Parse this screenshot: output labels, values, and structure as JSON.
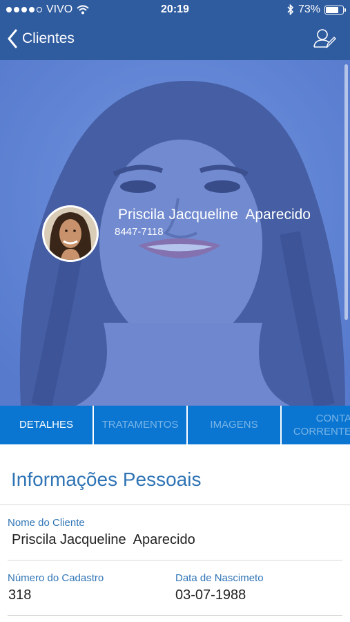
{
  "status_bar": {
    "carrier": "VIVO",
    "time": "20:19",
    "battery_percent": "73%",
    "battery_level": 0.73,
    "icons": [
      "signal-dots-icon",
      "wifi-icon",
      "bluetooth-icon",
      "battery-icon"
    ]
  },
  "nav": {
    "back_label": "Clientes",
    "back_icon": "chevron-left-icon",
    "right_icon": "edit-user-icon"
  },
  "profile": {
    "name": "Priscila Jacqueline  Aparecido",
    "phone": "8447-7118"
  },
  "tabs": [
    {
      "label": "DETALHES",
      "active": true
    },
    {
      "label": "TRATAMENTOS",
      "active": false
    },
    {
      "label": "IMAGENS",
      "active": false
    },
    {
      "label": "CONTA CORRENTE",
      "active": false
    }
  ],
  "section": {
    "title": "Informações Pessoais"
  },
  "fields": {
    "nome_label": "Nome do Cliente",
    "nome_value": "Priscila Jacqueline  Aparecido",
    "cadastro_label": "Número do Cadastro",
    "cadastro_value": "318",
    "nascimento_label": "Data de Nascimeto",
    "nascimento_value": "03-07-1988"
  },
  "colors": {
    "nav_bg": "#2f5b9f",
    "tab_bg": "#0a76d2",
    "accent_text": "#2f74b5"
  }
}
